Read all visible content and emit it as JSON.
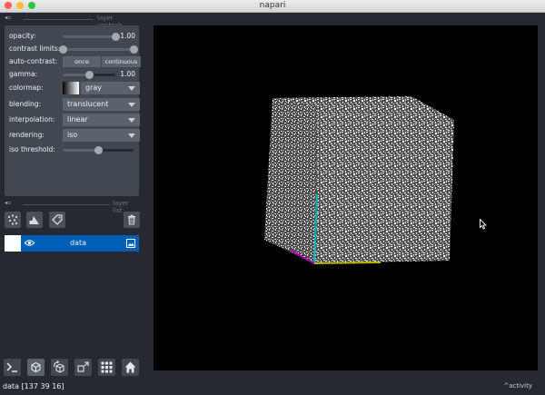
{
  "window": {
    "title": "napari"
  },
  "layer_controls": {
    "header": "layer controls",
    "opacity": {
      "label": "opacity:",
      "value": "1.00",
      "fraction": 1.0
    },
    "contrast_limits": {
      "label": "contrast limits:",
      "low_fraction": 0.0,
      "high_fraction": 1.0
    },
    "auto_contrast": {
      "label": "auto-contrast:",
      "once": "once",
      "continuous": "continuous"
    },
    "gamma": {
      "label": "gamma:",
      "value": "1.00",
      "fraction": 0.5
    },
    "colormap": {
      "label": "colormap:",
      "value": "gray"
    },
    "blending": {
      "label": "blending:",
      "value": "translucent"
    },
    "interpolation": {
      "label": "interpolation:",
      "value": "linear"
    },
    "rendering": {
      "label": "rendering:",
      "value": "iso"
    },
    "iso_threshold": {
      "label": "iso threshold:",
      "fraction": 0.5
    }
  },
  "layer_list": {
    "header": "layer list",
    "layers": [
      {
        "name": "data",
        "selected": true,
        "visible": true
      }
    ]
  },
  "status_bar": {
    "text": "data [137  39  16]",
    "activity": "activity"
  },
  "colors": {
    "background": "#262930",
    "panel": "#414851",
    "selection": "#005fb7",
    "canvas": "#000000",
    "axis_x": "#00b4b4",
    "axis_y": "#b400b4",
    "axis_z": "#b4b400"
  }
}
